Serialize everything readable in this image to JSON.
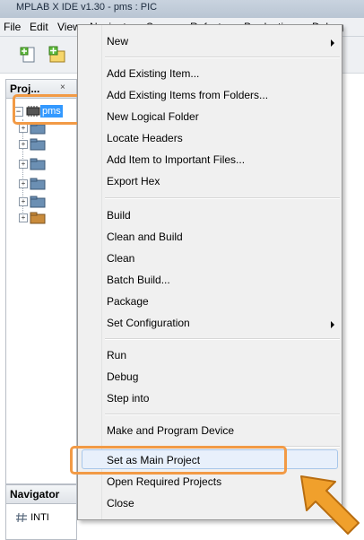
{
  "window": {
    "title": "MPLAB X IDE v1.30 - pms : PIC"
  },
  "menubar": {
    "items": [
      "File",
      "Edit",
      "View",
      "Navigate",
      "Source",
      "Refactor",
      "Production",
      "Debug"
    ]
  },
  "projects_panel": {
    "tab_label": "Proj...",
    "close_glyph": "×",
    "root_item": "pms",
    "expand_glyph": "−",
    "child_expand_glyph": "+"
  },
  "navigator_panel": {
    "tab_label": "Navigator",
    "row_label": "INTI"
  },
  "context_menu": {
    "groups": [
      [
        "New"
      ],
      [
        "Add Existing Item...",
        "Add Existing Items from Folders...",
        "New Logical Folder",
        "Locate Headers",
        "Add Item to Important Files...",
        "Export Hex"
      ],
      [
        "Build",
        "Clean and Build",
        "Clean",
        "Batch Build...",
        "Package",
        "Set Configuration"
      ],
      [
        "Run",
        "Debug",
        "Step into"
      ],
      [
        "Make and Program Device"
      ],
      [
        "Set as Main Project",
        "Open Required Projects",
        "Close"
      ]
    ]
  },
  "colors": {
    "highlight_orange": "#f29a45",
    "selection_blue": "#3399ff",
    "arrow_orange": "#f0a02c"
  }
}
